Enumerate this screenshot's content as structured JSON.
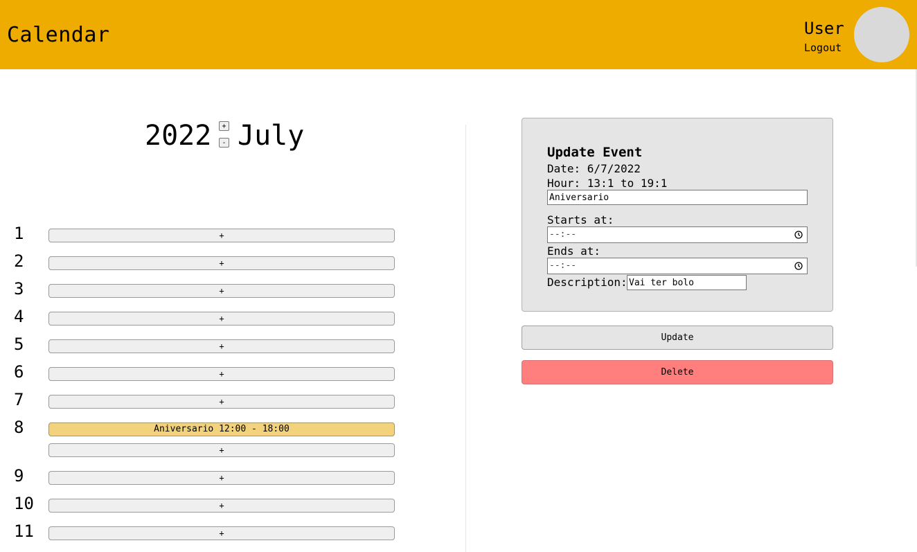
{
  "header": {
    "title": "Calendar",
    "user_name": "User",
    "logout_label": "Logout"
  },
  "calendar": {
    "year": "2022",
    "month": "July",
    "increment_label": "+",
    "decrement_label": "-",
    "add_label": "+",
    "days": [
      {
        "label": "1",
        "events": []
      },
      {
        "label": "2",
        "events": []
      },
      {
        "label": "3",
        "events": []
      },
      {
        "label": "4",
        "events": []
      },
      {
        "label": "5",
        "events": []
      },
      {
        "label": "6",
        "events": []
      },
      {
        "label": "7",
        "events": []
      },
      {
        "label": "8",
        "events": [
          "Aniversario 12:00 - 18:00"
        ]
      },
      {
        "label": "9",
        "events": []
      },
      {
        "label": "10",
        "events": []
      },
      {
        "label": "11",
        "events": []
      }
    ]
  },
  "update_panel": {
    "title": "Update Event",
    "date_line": "Date: 6/7/2022",
    "hour_line": "Hour: 13:1 to 19:1",
    "name_value": "Aniversario",
    "starts_label": "Starts at:",
    "starts_value": "--:--",
    "ends_label": "Ends at:",
    "ends_value": "--:--",
    "description_label": "Description:",
    "description_value": "Vai ter bolo"
  },
  "actions": {
    "update_label": "Update",
    "delete_label": "Delete"
  },
  "colors": {
    "header": "#eeac00",
    "event": "#f3d27d",
    "delete": "#ff7f7f",
    "panel": "#e5e5e5"
  }
}
